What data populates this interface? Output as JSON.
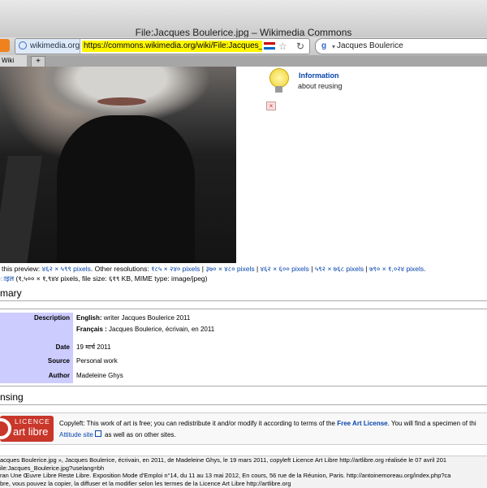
{
  "window": {
    "title": "File:Jacques Boulerice.jpg – Wikimedia Commons"
  },
  "toolbar": {
    "site_badge": "wikimedia.org",
    "url": "https://commons.wikimedia.org/wiki/File:Jacques_Boul",
    "search_value": "Jacques Boulerice"
  },
  "tabs": [
    {
      "label": "Wiki"
    }
  ],
  "sidebar": {
    "info_title": "Information",
    "info_subtitle": "about reusing"
  },
  "resolution": {
    "prefix": "this preview: ",
    "preview": "४६२ × ५९९ pixels",
    "other_label": ". Other resolutions: ",
    "res1": "१८५ × २४० pixels",
    "res2": "३७० × ४८० pixels",
    "res3": "४६२ × ६०० pixels",
    "res4": "५९२ × ७६८ pixels",
    "res5": "७९० × १,०२४ pixels",
    "end": "."
  },
  "original": {
    "link": "ाइल",
    "text": " (१,५०० × १,९४४ pixels, file size: ६१९ KB, MIME type: image/jpeg)"
  },
  "summary": {
    "heading": "mary",
    "desc_label": "Description",
    "desc_en_lang": "English:",
    "desc_en": " writer Jacques Boulerice 2011",
    "desc_fr_lang": "Français :",
    "desc_fr": " Jacques Boulerice, écrivain, en 2011",
    "date_label": "Date",
    "date": "19 मार्च 2011",
    "source_label": "Source",
    "source": "Personal work",
    "author_label": "Author",
    "author": "Madeleine Ghys"
  },
  "licensing": {
    "heading": "nsing",
    "logo_top": "LICENCE",
    "logo_main": "art libre",
    "copyleft_pre": "Copyleft: This work of art is free; you can redistribute it and/or modify it according to terms of the ",
    "fal_link": "Free Art License",
    "copyleft_post": ". You will find a specimen of thi",
    "attitude_link": "Attitude site",
    "attitude_post": " as well as on other sites."
  },
  "footer": {
    "line1": "acques Boulerice.jpg », Jacques Boulerice, écrivain, en 2011, de Madeleine Ghys, le 19 mars 2011, copyleft Licence Art Libre http://artlibre.org réalisée le 07 avril 201",
    "line2": "ile:Jacques_Boulerice.jpg?uselang=bh",
    "line3": "ran Une Œuvre Libre Reste Libre. Exposition Mode d'Emploi n°14, du 11 au 13 mai 2012, En cours, 56 rue de la Réunion, Paris. http://antoinemoreau.org/index.php?ca",
    "line4": "bre, vous pouvez la copier, la diffuser et la modifier selon les termes de la Licence Art Libre http://artlibre.org"
  }
}
